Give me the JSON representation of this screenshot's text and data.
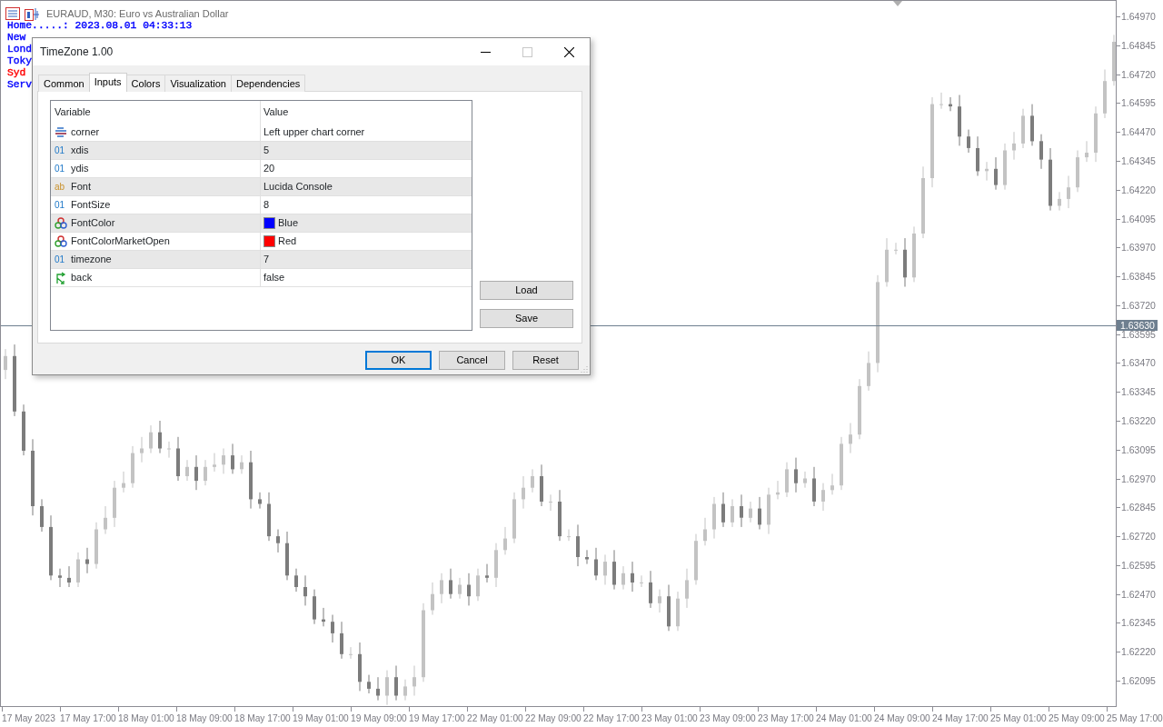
{
  "chart_header": {
    "title": "EURAUD, M30:  Euro vs Australian Dollar"
  },
  "info_lines": [
    {
      "text": "Home.....: 2023.08.01 04:33:13",
      "color": "#0000ff"
    },
    {
      "text": "New",
      "color": "#0000ff"
    },
    {
      "text": "Lond",
      "color": "#0000ff"
    },
    {
      "text": "Toky",
      "color": "#0000ff"
    },
    {
      "text": "Syd",
      "color": "#ff0000"
    },
    {
      "text": "Serv",
      "color": "#0000ff"
    }
  ],
  "chart": {
    "chart_data": {
      "type": "candlestick",
      "categories": [
        null,
        null,
        null,
        "17 May 2023",
        null,
        null,
        null,
        null,
        null,
        "17 May 17:00",
        null,
        null,
        null,
        null,
        null,
        null,
        "18 May 01:00",
        null,
        null,
        null,
        null,
        null,
        "18 May 09:00",
        null,
        null,
        null,
        null,
        null,
        "18 May 17:00",
        null,
        null,
        null,
        null,
        null,
        null,
        "19 May 01:00",
        null,
        null,
        null,
        null,
        null,
        "19 May 09:00",
        null,
        null,
        null,
        null,
        null,
        null,
        "19 May 17:00",
        null,
        null,
        null,
        null,
        null,
        "22 May 01:00",
        null,
        null,
        null,
        null,
        null,
        "22 May 09:00",
        null,
        null,
        null,
        null,
        null,
        null,
        "22 May 17:00",
        null,
        null,
        null,
        null,
        null,
        "23 May 01:00",
        null,
        null,
        null,
        null,
        null,
        null,
        "23 May 09:00",
        null,
        null,
        null,
        null,
        null,
        "23 May 17:00",
        null,
        null,
        null,
        null,
        null,
        "24 May 01:00",
        null,
        null,
        null,
        null,
        null,
        null,
        "24 May 09:00",
        null,
        null,
        null,
        null,
        null,
        "24 May 17:00",
        null,
        null,
        null,
        null,
        null,
        null,
        "25 May 01:00",
        null,
        null,
        null,
        null,
        null,
        "25 May 09:00",
        null,
        null,
        null,
        null
      ],
      "ohlc": [
        [
          1.6344,
          1.6353,
          1.634,
          1.635
        ],
        [
          1.635,
          1.6355,
          1.6324,
          1.6326
        ],
        [
          1.6326,
          1.6329,
          1.6307,
          1.6309
        ],
        [
          1.6309,
          1.6314,
          1.6281,
          1.6285
        ],
        [
          1.6285,
          1.6288,
          1.6274,
          1.6276
        ],
        [
          1.6276,
          1.6281,
          1.6253,
          1.6255
        ],
        [
          1.6255,
          1.6258,
          1.625,
          1.6254
        ],
        [
          1.6254,
          1.6259,
          1.625,
          1.6252
        ],
        [
          1.6252,
          1.6265,
          1.625,
          1.6262
        ],
        [
          1.6262,
          1.6267,
          1.6256,
          1.626
        ],
        [
          1.626,
          1.6278,
          1.6258,
          1.6275
        ],
        [
          1.6275,
          1.6285,
          1.6273,
          1.628
        ],
        [
          1.628,
          1.6296,
          1.6276,
          1.6293
        ],
        [
          1.6293,
          1.63,
          1.6291,
          1.6295
        ],
        [
          1.6295,
          1.6311,
          1.6293,
          1.6308
        ],
        [
          1.6308,
          1.6315,
          1.6304,
          1.631
        ],
        [
          1.631,
          1.632,
          1.6308,
          1.6317
        ],
        [
          1.6317,
          1.6322,
          1.6308,
          1.631
        ],
        [
          1.631,
          1.6313,
          1.6306,
          1.631
        ],
        [
          1.631,
          1.6315,
          1.6296,
          1.6298
        ],
        [
          1.6298,
          1.6305,
          1.6296,
          1.6302
        ],
        [
          1.6302,
          1.6307,
          1.6292,
          1.6296
        ],
        [
          1.6296,
          1.6305,
          1.6294,
          1.6302
        ],
        [
          1.6302,
          1.6308,
          1.63,
          1.6303
        ],
        [
          1.6303,
          1.631,
          1.6299,
          1.6307
        ],
        [
          1.6307,
          1.6312,
          1.6299,
          1.6301
        ],
        [
          1.6301,
          1.6307,
          1.6299,
          1.6304
        ],
        [
          1.6304,
          1.6309,
          1.6284,
          1.6288
        ],
        [
          1.6288,
          1.6291,
          1.6284,
          1.6286
        ],
        [
          1.6286,
          1.6291,
          1.627,
          1.6272
        ],
        [
          1.6272,
          1.6275,
          1.6265,
          1.6269
        ],
        [
          1.6269,
          1.6274,
          1.6253,
          1.6255
        ],
        [
          1.6255,
          1.6258,
          1.6248,
          1.625
        ],
        [
          1.625,
          1.6255,
          1.6242,
          1.6246
        ],
        [
          1.6246,
          1.6249,
          1.6234,
          1.6236
        ],
        [
          1.6236,
          1.6241,
          1.6233,
          1.6235
        ],
        [
          1.6235,
          1.6238,
          1.6226,
          1.623
        ],
        [
          1.623,
          1.6235,
          1.6219,
          1.6221
        ],
        [
          1.6221,
          1.6224,
          1.6219,
          1.6221
        ],
        [
          1.6221,
          1.6226,
          1.6205,
          1.6209
        ],
        [
          1.6209,
          1.6212,
          1.6204,
          1.6206
        ],
        [
          1.6206,
          1.6211,
          1.6201,
          1.6203
        ],
        [
          1.6203,
          1.6214,
          1.6199,
          1.6211
        ],
        [
          1.6211,
          1.6216,
          1.6201,
          1.6203
        ],
        [
          1.6203,
          1.621,
          1.6201,
          1.6207
        ],
        [
          1.6207,
          1.6216,
          1.6203,
          1.6211
        ],
        [
          1.6211,
          1.6243,
          1.6209,
          1.624
        ],
        [
          1.624,
          1.6252,
          1.6238,
          1.6247
        ],
        [
          1.6247,
          1.6256,
          1.6243,
          1.6253
        ],
        [
          1.6253,
          1.6258,
          1.6245,
          1.6247
        ],
        [
          1.6247,
          1.6254,
          1.6245,
          1.6251
        ],
        [
          1.6251,
          1.6256,
          1.6242,
          1.6246
        ],
        [
          1.6246,
          1.6258,
          1.6244,
          1.6255
        ],
        [
          1.6255,
          1.626,
          1.6252,
          1.6254
        ],
        [
          1.6254,
          1.6269,
          1.625,
          1.6266
        ],
        [
          1.6266,
          1.6276,
          1.6264,
          1.6271
        ],
        [
          1.6271,
          1.6291,
          1.6269,
          1.6288
        ],
        [
          1.6288,
          1.6298,
          1.6284,
          1.6293
        ],
        [
          1.6293,
          1.6301,
          1.6291,
          1.6298
        ],
        [
          1.6298,
          1.6303,
          1.6285,
          1.6287
        ],
        [
          1.6287,
          1.629,
          1.6283,
          1.6287
        ],
        [
          1.6287,
          1.6292,
          1.627,
          1.6272
        ],
        [
          1.6272,
          1.6275,
          1.627,
          1.6272
        ],
        [
          1.6272,
          1.6277,
          1.6259,
          1.6263
        ],
        [
          1.6263,
          1.6266,
          1.626,
          1.6262
        ],
        [
          1.6262,
          1.6267,
          1.6253,
          1.6255
        ],
        [
          1.6255,
          1.6264,
          1.6251,
          1.6261
        ],
        [
          1.6261,
          1.6266,
          1.6249,
          1.6251
        ],
        [
          1.6251,
          1.6259,
          1.6249,
          1.6256
        ],
        [
          1.6256,
          1.6261,
          1.6248,
          1.6252
        ],
        [
          1.6252,
          1.6255,
          1.625,
          1.6252
        ],
        [
          1.6252,
          1.6257,
          1.6241,
          1.6243
        ],
        [
          1.6243,
          1.6249,
          1.6239,
          1.6246
        ],
        [
          1.6246,
          1.6251,
          1.6231,
          1.6233
        ],
        [
          1.6233,
          1.6248,
          1.6231,
          1.6245
        ],
        [
          1.6245,
          1.6258,
          1.6241,
          1.6253
        ],
        [
          1.6253,
          1.6273,
          1.6251,
          1.627
        ],
        [
          1.627,
          1.628,
          1.6268,
          1.6275
        ],
        [
          1.6275,
          1.6289,
          1.6271,
          1.6286
        ],
        [
          1.6286,
          1.6291,
          1.6276,
          1.6278
        ],
        [
          1.6278,
          1.6288,
          1.6276,
          1.6285
        ],
        [
          1.6285,
          1.629,
          1.6276,
          1.628
        ],
        [
          1.628,
          1.6287,
          1.6278,
          1.6284
        ],
        [
          1.6284,
          1.6289,
          1.6275,
          1.6277
        ],
        [
          1.6277,
          1.6293,
          1.6273,
          1.629
        ],
        [
          1.629,
          1.6296,
          1.6288,
          1.6291
        ],
        [
          1.6291,
          1.6304,
          1.6289,
          1.6301
        ],
        [
          1.6301,
          1.6306,
          1.6291,
          1.6295
        ],
        [
          1.6295,
          1.63,
          1.6293,
          1.6297
        ],
        [
          1.6297,
          1.6302,
          1.6285,
          1.6287
        ],
        [
          1.6287,
          1.6295,
          1.6283,
          1.6292
        ],
        [
          1.6292,
          1.6299,
          1.629,
          1.6294
        ],
        [
          1.6294,
          1.6315,
          1.6292,
          1.6312
        ],
        [
          1.6312,
          1.6321,
          1.6308,
          1.6316
        ],
        [
          1.6316,
          1.634,
          1.6314,
          1.6337
        ],
        [
          1.6337,
          1.6352,
          1.6335,
          1.6347
        ],
        [
          1.6347,
          1.6385,
          1.6343,
          1.6382
        ],
        [
          1.6382,
          1.6401,
          1.638,
          1.6396
        ],
        [
          1.6396,
          1.6399,
          1.6394,
          1.6396
        ],
        [
          1.6396,
          1.6401,
          1.638,
          1.6384
        ],
        [
          1.6384,
          1.6406,
          1.6382,
          1.6403
        ],
        [
          1.6403,
          1.6432,
          1.6401,
          1.6427
        ],
        [
          1.6427,
          1.6462,
          1.6423,
          1.6459
        ],
        [
          1.6459,
          1.6464,
          1.6457,
          1.6459
        ],
        [
          1.6459,
          1.6462,
          1.6456,
          1.6458
        ],
        [
          1.6458,
          1.6463,
          1.6441,
          1.6445
        ],
        [
          1.6445,
          1.6448,
          1.6438,
          1.644
        ],
        [
          1.644,
          1.6445,
          1.6428,
          1.643
        ],
        [
          1.643,
          1.6434,
          1.6426,
          1.6431
        ],
        [
          1.6431,
          1.6436,
          1.6422,
          1.6424
        ],
        [
          1.6424,
          1.6442,
          1.6422,
          1.6439
        ],
        [
          1.6439,
          1.6447,
          1.6435,
          1.6442
        ],
        [
          1.6442,
          1.6457,
          1.644,
          1.6454
        ],
        [
          1.6454,
          1.6459,
          1.6441,
          1.6443
        ],
        [
          1.6443,
          1.6446,
          1.6431,
          1.6435
        ],
        [
          1.6435,
          1.644,
          1.6413,
          1.6415
        ],
        [
          1.6415,
          1.6421,
          1.6413,
          1.6418
        ],
        [
          1.6418,
          1.6428,
          1.6414,
          1.6423
        ],
        [
          1.6423,
          1.6439,
          1.6421,
          1.6436
        ],
        [
          1.6436,
          1.6443,
          1.6434,
          1.6438
        ],
        [
          1.6438,
          1.6458,
          1.6434,
          1.6455
        ],
        [
          1.6455,
          1.6474,
          1.6453,
          1.6469
        ],
        [
          1.6469,
          1.6489,
          1.6467,
          1.6486
        ]
      ],
      "ylim": [
        1.61977,
        1.65037
      ],
      "yticks": [
        {
          "value": 1.6497,
          "label": "1.64970"
        },
        {
          "value": 1.64845,
          "label": "1.64845"
        },
        {
          "value": 1.6472,
          "label": "1.64720"
        },
        {
          "value": 1.64595,
          "label": "1.64595"
        },
        {
          "value": 1.6447,
          "label": "1.64470"
        },
        {
          "value": 1.64345,
          "label": "1.64345"
        },
        {
          "value": 1.6422,
          "label": "1.64220"
        },
        {
          "value": 1.64095,
          "label": "1.64095"
        },
        {
          "value": 1.6397,
          "label": "1.63970"
        },
        {
          "value": 1.63845,
          "label": "1.63845"
        },
        {
          "value": 1.6372,
          "label": "1.63720"
        },
        {
          "value": 1.63595,
          "label": "1.63595"
        },
        {
          "value": 1.6347,
          "label": "1.63470"
        },
        {
          "value": 1.63345,
          "label": "1.63345"
        },
        {
          "value": 1.6322,
          "label": "1.63220"
        },
        {
          "value": 1.63095,
          "label": "1.63095"
        },
        {
          "value": 1.6297,
          "label": "1.62970"
        },
        {
          "value": 1.62845,
          "label": "1.62845"
        },
        {
          "value": 1.6272,
          "label": "1.62720"
        },
        {
          "value": 1.62595,
          "label": "1.62595"
        },
        {
          "value": 1.6247,
          "label": "1.62470"
        },
        {
          "value": 1.62345,
          "label": "1.62345"
        },
        {
          "value": 1.6222,
          "label": "1.62220"
        },
        {
          "value": 1.62095,
          "label": "1.62095"
        }
      ],
      "ref_lines": [
        {
          "axis": "y",
          "value": 1.6363,
          "label": "1.63630"
        }
      ]
    }
  },
  "time_axis": {
    "labels": [
      "25 May 17:00"
    ]
  },
  "dialog": {
    "title": "TimeZone 1.00",
    "tabs": [
      {
        "label": "Common",
        "selected": false
      },
      {
        "label": "Inputs",
        "selected": true
      },
      {
        "label": "Colors",
        "selected": false
      },
      {
        "label": "Visualization",
        "selected": false
      },
      {
        "label": "Dependencies",
        "selected": false
      }
    ],
    "columns": [
      "Variable",
      "Value"
    ],
    "rows": [
      {
        "kind": "enum",
        "variable": "corner",
        "value": "Left upper chart corner"
      },
      {
        "kind": "int",
        "type_mark": "01",
        "variable": "xdis",
        "value": "5"
      },
      {
        "kind": "int",
        "type_mark": "01",
        "variable": "ydis",
        "value": "20"
      },
      {
        "kind": "string",
        "type_mark": "ab",
        "variable": "Font",
        "value": "Lucida Console"
      },
      {
        "kind": "int",
        "type_mark": "01",
        "variable": "FontSize",
        "value": "8"
      },
      {
        "kind": "color",
        "variable": "FontColor",
        "value": "Blue",
        "color": "#0000ff"
      },
      {
        "kind": "color",
        "variable": "FontColorMarketOpen",
        "value": "Red",
        "color": "#ff0000"
      },
      {
        "kind": "int",
        "type_mark": "01",
        "variable": "timezone",
        "value": "7"
      },
      {
        "kind": "bool",
        "variable": "back",
        "value": "false"
      }
    ],
    "side_buttons": [
      "Load",
      "Save"
    ],
    "buttons": [
      {
        "label": "OK",
        "default": true
      },
      {
        "label": "Cancel",
        "default": false
      },
      {
        "label": "Reset",
        "default": false
      }
    ]
  }
}
